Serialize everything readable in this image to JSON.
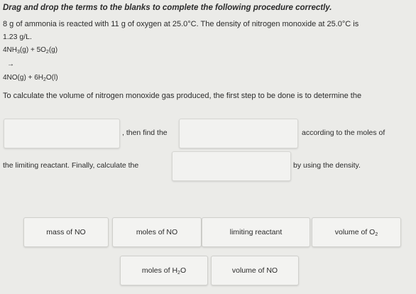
{
  "instructions": "Drag and drop the terms to the blanks to complete the following procedure correctly.",
  "problem": {
    "line1": "8 g of ammonia is reacted with 11 g of oxygen at 25.0°C. The density of nitrogen monoxide at 25.0°C is",
    "line2": "1.23 g/L."
  },
  "equation": {
    "reactant1_coef": "4NH",
    "reactant1_sub": "3",
    "reactant1_state": "(g)",
    "plus": "+",
    "reactant2_coef": "5O",
    "reactant2_sub": "2",
    "reactant2_state": "(g)",
    "arrow": "→",
    "product1": "4NO(g)",
    "product2_coef": "6H",
    "product2_sub": "2",
    "product2_state": "O(l)"
  },
  "question": {
    "line1": "To calculate the volume of nitrogen monoxide gas produced, the first step to be done is to determine the",
    "then_find": ", then find the",
    "according": "according to the moles of",
    "limiting": "the limiting reactant. Finally, calculate the",
    "by_density": "by using the density."
  },
  "tiles": {
    "mass_no": "mass of NO",
    "moles_no": "moles of NO",
    "limiting": "limiting reactant",
    "volume_o2_prefix": "volume of O",
    "volume_o2_sub": "2",
    "moles_h2o_prefix": "moles of H",
    "moles_h2o_sub": "2",
    "moles_h2o_suffix": "O",
    "volume_no": "volume of NO"
  }
}
